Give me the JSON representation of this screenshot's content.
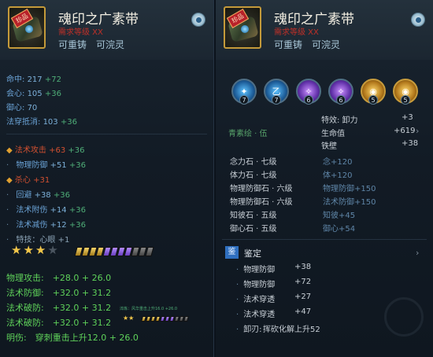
{
  "left": {
    "badge": "珍品",
    "title": "魂印之广素带",
    "redline": "需求等级 XX",
    "recast": "可重铸　可浣灵",
    "base_stats": [
      {
        "label": "命中:",
        "value": "217",
        "add": "+72"
      },
      {
        "label": "会心:",
        "value": "105",
        "add": "+36"
      },
      {
        "label": "御心:",
        "value": "70",
        "add": ""
      },
      {
        "label": "法穿抵消:",
        "value": "103",
        "add": "+36"
      }
    ],
    "extra_stats": [
      {
        "label": "法术攻击",
        "value": "+63",
        "add": "+36",
        "color": "red",
        "icon": "gold"
      },
      {
        "label": "物理防御",
        "value": "+51",
        "add": "+36",
        "color": "blue",
        "icon": "dot"
      },
      {
        "label": "杀心",
        "value": "+31",
        "add": "",
        "color": "red",
        "icon": "gold"
      },
      {
        "label": "回避",
        "value": "+38",
        "add": "+36",
        "color": "blue",
        "icon": "dot"
      },
      {
        "label": "法术附伤",
        "value": "+14",
        "add": "+36",
        "color": "blue",
        "icon": "dot"
      },
      {
        "label": "法术减伤",
        "value": "+12",
        "add": "+36",
        "color": "blue",
        "icon": "dot"
      },
      {
        "label": "特技：心眼",
        "value": "+1",
        "add": "",
        "color": "dim",
        "icon": "dot"
      }
    ],
    "stars": 3,
    "bars": {
      "gold": 4,
      "purple": 4,
      "grey": 3
    },
    "green_stats": [
      "物理攻击:　+28.0 + 26.0",
      "法术防御:　+32.0 + 31.2",
      "法术破防:　+32.0 + 31.2",
      "法术破防:　+32.0 + 31.2",
      "明伤:　穿刺重击上升12.0 + 26.0"
    ],
    "small_note": "淬炼：风华重击上升16.0 +26.0"
  },
  "right": {
    "badge": "珍品",
    "title": "魂印之广素带",
    "redline": "需求等级 XX",
    "recast": "可重铸　可浣灵",
    "gems": [
      {
        "type": "blue",
        "lv": "7",
        "glyph": "✦"
      },
      {
        "type": "blue",
        "lv": "7",
        "glyph": "乙"
      },
      {
        "type": "purple",
        "lv": "6",
        "glyph": "✧"
      },
      {
        "type": "purple",
        "lv": "6",
        "glyph": "✧"
      },
      {
        "type": "gold",
        "lv": "5",
        "glyph": "◉"
      },
      {
        "type": "gold",
        "lv": "5",
        "glyph": "◉"
      }
    ],
    "set_name": "青素绘 · 伍",
    "set_stats": [
      {
        "label": "特效: 卸力",
        "value": "+3"
      },
      {
        "label": "生命值",
        "value": "+619"
      },
      {
        "label": "铁壁",
        "value": "+38"
      }
    ],
    "stones": [
      {
        "name": "念力石 · 七级",
        "effect": "念+120"
      },
      {
        "name": "体力石 · 七级",
        "effect": "体+120"
      },
      {
        "name": "物理防御石 · 六级",
        "effect": "物理防御+150"
      },
      {
        "name": "物理防御石 · 六级",
        "effect": "法术防御+150"
      },
      {
        "name": "知彼石 · 五级",
        "effect": "知彼+45"
      },
      {
        "name": "御心石 · 五级",
        "effect": "御心+54"
      }
    ],
    "appraise_icon": "鉴",
    "appraise_label": "鉴定",
    "appraise_stats": [
      {
        "label": "物理防御",
        "value": "+38"
      },
      {
        "label": "物理防御",
        "value": "+72"
      },
      {
        "label": "法术穿透",
        "value": "+27"
      },
      {
        "label": "法术穿透",
        "value": "+47"
      },
      {
        "label": "卸刃:",
        "value": "挥砍化解上升52"
      }
    ]
  }
}
